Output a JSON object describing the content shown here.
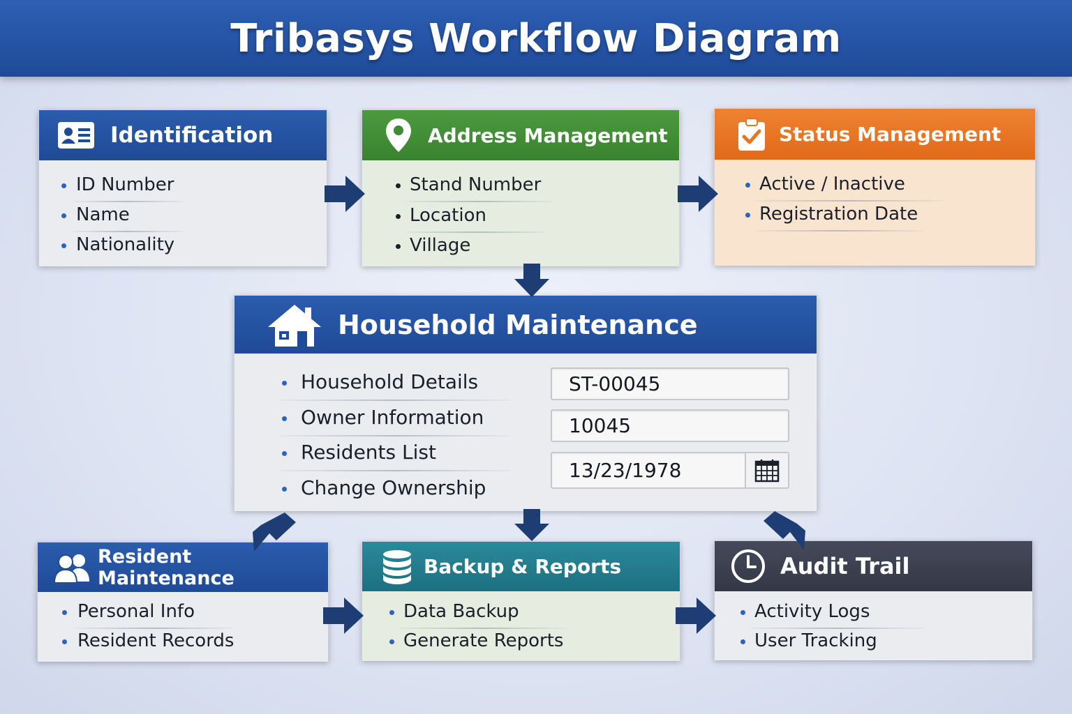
{
  "title": "Tribasys Workflow Diagram",
  "colors": {
    "primary_blue": "#1f4a9a",
    "green": "#3f8a34",
    "orange": "#e8751f",
    "teal": "#227b8b",
    "dark": "#3c404e",
    "arrow": "#1e3d75"
  },
  "identification": {
    "icon": "id-card-icon",
    "title": "Identification",
    "items": [
      "ID Number",
      "Name",
      "Nationality"
    ]
  },
  "address": {
    "icon": "map-pin-icon",
    "title": "Address Management",
    "items": [
      "Stand Number",
      "Location",
      "Village"
    ]
  },
  "status": {
    "icon": "clipboard-check-icon",
    "title": "Status Management",
    "items": [
      "Active / Inactive",
      "Registration Date"
    ]
  },
  "household": {
    "icon": "house-icon",
    "title": "Household Maintenance",
    "items": [
      "Household Details",
      "Owner Information",
      "Residents List",
      "Change Ownership"
    ],
    "fields": {
      "stand_number": "ST-00045",
      "household_id": "10045",
      "date": "13/23/1978"
    },
    "calendar_icon": "calendar-icon"
  },
  "resident": {
    "icon": "users-icon",
    "title": "Resident Maintenance",
    "items": [
      "Personal Info",
      "Resident Records"
    ]
  },
  "backup": {
    "icon": "database-icon",
    "title": "Backup & Reports",
    "items": [
      "Data Backup",
      "Generate Reports"
    ]
  },
  "audit": {
    "icon": "clock-icon",
    "title": "Audit Trail",
    "items": [
      "Activity Logs",
      "User Tracking"
    ]
  }
}
